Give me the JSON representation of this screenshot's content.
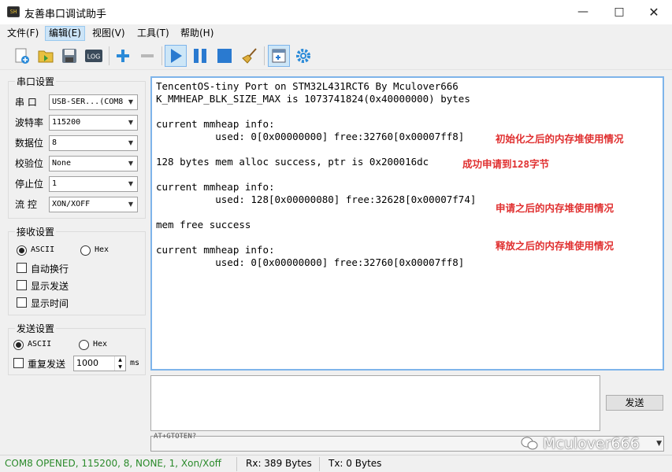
{
  "window": {
    "title": "友善串口调试助手",
    "icon": "app-icon"
  },
  "menu": [
    "文件(F)",
    "编辑(E)",
    "视图(V)",
    "工具(T)",
    "帮助(H)"
  ],
  "menu_active": "编辑(E)",
  "toolbar": [
    "new-icon",
    "open-icon",
    "save-icon",
    "log-icon",
    "plus-icon",
    "minus-icon",
    "play-icon",
    "pause-icon",
    "stop-icon",
    "broom-icon",
    "add-window-icon",
    "gear-icon"
  ],
  "toolbar_log_label": "LOG",
  "serial": {
    "title": "串口设置",
    "rows": [
      {
        "label": "串  口",
        "value": "USB-SER...(COM8"
      },
      {
        "label": "波特率",
        "value": "115200"
      },
      {
        "label": "数据位",
        "value": "8"
      },
      {
        "label": "校验位",
        "value": "None"
      },
      {
        "label": "停止位",
        "value": "1"
      },
      {
        "label": "流  控",
        "value": "XON/XOFF"
      }
    ]
  },
  "receive": {
    "title": "接收设置",
    "ascii": "ASCII",
    "hex": "Hex",
    "selected": "ASCII",
    "options": [
      "自动换行",
      "显示发送",
      "显示时间"
    ]
  },
  "send_settings": {
    "title": "发送设置",
    "ascii": "ASCII",
    "hex": "Hex",
    "selected": "ASCII",
    "repeat_label": "重复发送",
    "interval": "1000",
    "unit": "ms"
  },
  "output": {
    "lines": [
      "TencentOS-tiny Port on STM32L431RCT6 By Mculover666",
      "K_MMHEAP_BLK_SIZE_MAX is 1073741824(0x40000000) bytes",
      "",
      "current mmheap info:",
      "          used: 0[0x00000000] free:32760[0x00007ff8]",
      "",
      "128 bytes mem alloc success, ptr is 0x200016dc",
      "",
      "current mmheap info:",
      "          used: 128[0x00000080] free:32628[0x00007f74]",
      "",
      "mem free success",
      "",
      "current mmheap info:",
      "          used: 0[0x00000000] free:32760[0x00007ff8]"
    ],
    "annotations": [
      {
        "text": "初始化之后的内存堆使用情况",
        "line": 4
      },
      {
        "text": "成功申请到128字节",
        "line": 6
      },
      {
        "text": "申请之后的内存堆使用情况",
        "line": 9.5
      },
      {
        "text": "释放之后的内存堆使用情况",
        "line": 12.5
      }
    ],
    "annotation_color": "#e03030"
  },
  "send": {
    "button": "发送",
    "history_text": "AT+GTOTEN?",
    "watermark": "Mculover666"
  },
  "status": {
    "port": "COM8 OPENED, 115200, 8, NONE, 1, Xon/Xoff",
    "rx": "Rx: 389 Bytes",
    "tx": "Tx: 0 Bytes",
    "port_color": "#2a8a2a"
  }
}
